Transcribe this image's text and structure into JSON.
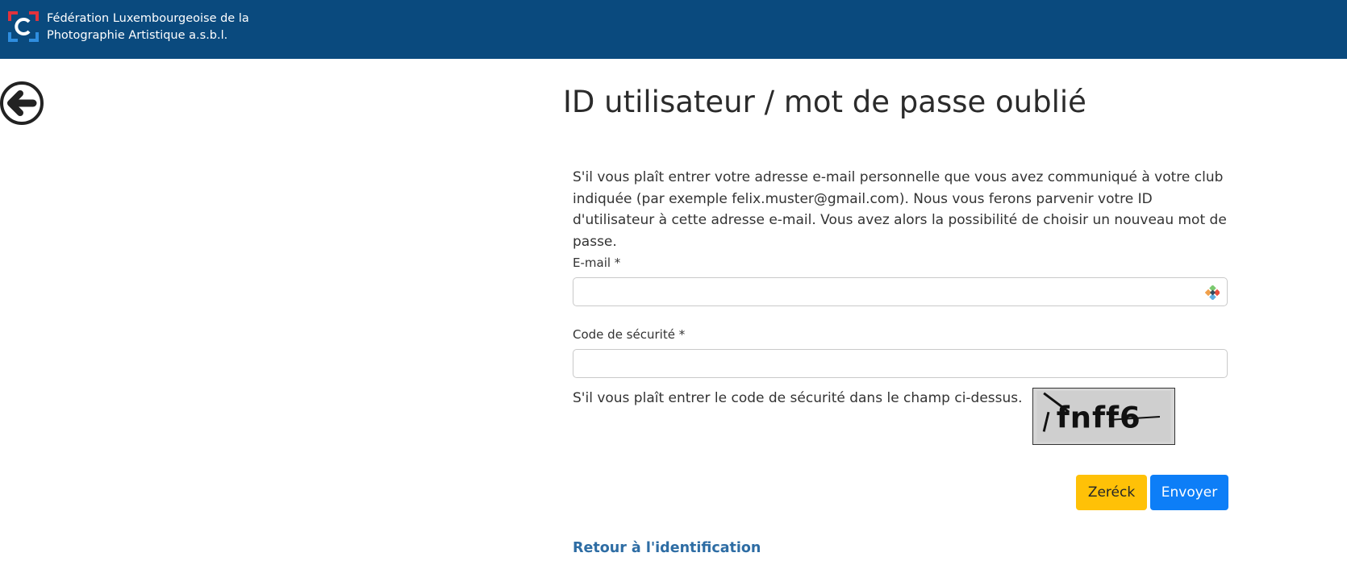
{
  "header": {
    "org_line1": "Fédération Luxembourgeoise de la",
    "org_line2": "Photographie Artistique a.s.b.l.",
    "logo_icon": "flpa-logo-icon",
    "background": "#0a4a7e"
  },
  "back_icon": "arrow-left-circle-icon",
  "page_title": "ID utilisateur / mot de passe oublié",
  "intro_text": "S'il vous plaît entrer votre adresse e-mail personnelle que vous avez communiqué à votre club indiquée (par exemple felix.muster@gmail.com). Nous vous ferons parvenir votre ID d'utilisateur à cette adresse e-mail. Vous avez alors la possibilité de choisir un nouveau mot de passe.",
  "form": {
    "email_label": "E-mail *",
    "email_value": "",
    "security_label": "Code de sécurité *",
    "security_value": "",
    "captcha_hint": "S'il vous plaît entrer le code de sécurité dans le champ ci-dessus.",
    "captcha_text": "fnff6"
  },
  "buttons": {
    "back_label": "Zeréck",
    "back_color": "#ffc107",
    "send_label": "Envoyer",
    "send_color": "#0d7ef7"
  },
  "return_link": "Retour à l'identification"
}
